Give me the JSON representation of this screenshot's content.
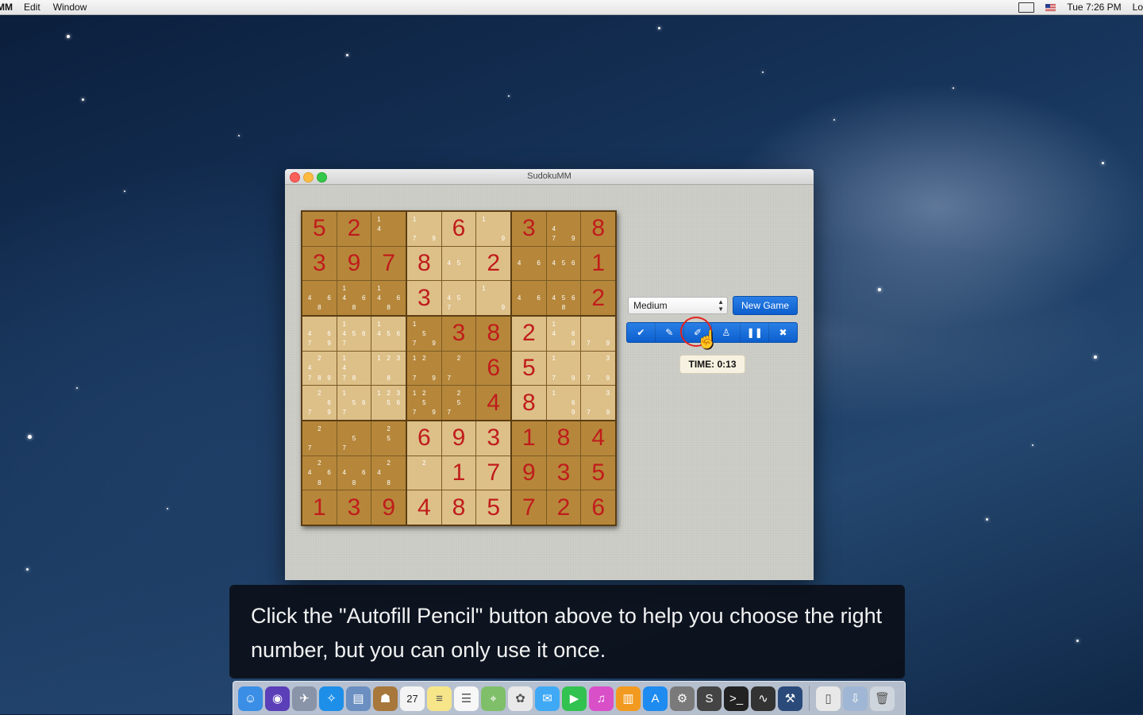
{
  "menubar": {
    "app_name": "MM",
    "menus": [
      "Edit",
      "Window"
    ],
    "clock": "Tue 7:26 PM",
    "trailing": "Lo"
  },
  "window": {
    "title": "SudokuMM"
  },
  "board": {
    "grid": [
      [
        {
          "v": "5"
        },
        {
          "v": "2"
        },
        {
          "n": [
            "1",
            "",
            "",
            "4",
            "",
            "",
            "",
            "",
            ""
          ]
        },
        {
          "n": [
            "1",
            "",
            "",
            "",
            "",
            "",
            "7",
            "",
            "9"
          ]
        },
        {
          "v": "6"
        },
        {
          "n": [
            "1",
            "",
            "",
            "",
            "",
            "",
            "",
            "",
            "9"
          ]
        },
        {
          "v": "3"
        },
        {
          "n": [
            "",
            "",
            "",
            "4",
            "",
            "",
            "7",
            "",
            "9"
          ]
        },
        {
          "v": "8"
        }
      ],
      [
        {
          "v": "3"
        },
        {
          "v": "9"
        },
        {
          "v": "7"
        },
        {
          "v": "8"
        },
        {
          "n": [
            "",
            "",
            "",
            "4",
            "5",
            "",
            "",
            "",
            ""
          ]
        },
        {
          "v": "2"
        },
        {
          "n": [
            "",
            "",
            "",
            "4",
            "",
            "6",
            "",
            "",
            ""
          ]
        },
        {
          "n": [
            "",
            "",
            "",
            "4",
            "5",
            "6",
            "",
            "",
            ""
          ]
        },
        {
          "v": "1"
        }
      ],
      [
        {
          "n": [
            "",
            "",
            "",
            "4",
            "",
            "6",
            "",
            "8",
            ""
          ]
        },
        {
          "n": [
            "1",
            "",
            "",
            "4",
            "",
            "6",
            "",
            "8",
            ""
          ]
        },
        {
          "n": [
            "1",
            "",
            "",
            "4",
            "",
            "6",
            "",
            "8",
            ""
          ]
        },
        {
          "v": "3"
        },
        {
          "n": [
            "",
            "",
            "",
            "4",
            "5",
            "",
            "7",
            "",
            ""
          ]
        },
        {
          "n": [
            "1",
            "",
            "",
            "",
            "",
            "",
            "",
            "",
            "9"
          ]
        },
        {
          "n": [
            "",
            "",
            "",
            "4",
            "",
            "6",
            "",
            "",
            ""
          ]
        },
        {
          "n": [
            "",
            "",
            "",
            "4",
            "5",
            "6",
            "",
            "8",
            ""
          ]
        },
        {
          "v": "2"
        }
      ],
      [
        {
          "n": [
            "",
            "",
            "",
            "4",
            "",
            "6",
            "7",
            "",
            "9"
          ]
        },
        {
          "n": [
            "1",
            "",
            "",
            "4",
            "5",
            "6",
            "7",
            "",
            ""
          ]
        },
        {
          "n": [
            "1",
            "",
            "",
            "4",
            "5",
            "6",
            "",
            "",
            ""
          ]
        },
        {
          "n": [
            "1",
            "",
            "",
            "",
            "5",
            "",
            "7",
            "",
            "9"
          ]
        },
        {
          "v": "3"
        },
        {
          "v": "8"
        },
        {
          "v": "2"
        },
        {
          "n": [
            "1",
            "",
            "",
            "4",
            "",
            "6",
            "",
            "",
            "9"
          ]
        },
        {
          "n": [
            "",
            "",
            "",
            "",
            "",
            "",
            "7",
            "",
            "9"
          ]
        }
      ],
      [
        {
          "n": [
            "",
            "2",
            "",
            "4",
            "",
            "",
            "7",
            "8",
            "9"
          ]
        },
        {
          "n": [
            "1",
            "",
            "",
            "4",
            "",
            "",
            "7",
            "8",
            ""
          ]
        },
        {
          "n": [
            "1",
            "2",
            "3",
            "",
            "",
            "",
            "",
            "8",
            ""
          ]
        },
        {
          "n": [
            "1",
            "2",
            "",
            "",
            "",
            "",
            "7",
            "",
            "9"
          ]
        },
        {
          "n": [
            "",
            "2",
            "",
            "",
            "",
            "",
            "7",
            "",
            ""
          ]
        },
        {
          "v": "6"
        },
        {
          "v": "5"
        },
        {
          "n": [
            "1",
            "",
            "",
            "",
            "",
            "",
            "7",
            "",
            "9"
          ]
        },
        {
          "n": [
            "",
            "",
            "3",
            "",
            "",
            "",
            "7",
            "",
            "9"
          ]
        }
      ],
      [
        {
          "n": [
            "",
            "2",
            "",
            "",
            "",
            "6",
            "7",
            "",
            "9"
          ]
        },
        {
          "n": [
            "1",
            "",
            "",
            "",
            "5",
            "6",
            "7",
            "",
            ""
          ]
        },
        {
          "n": [
            "1",
            "2",
            "3",
            "",
            "5",
            "6",
            "",
            "",
            ""
          ]
        },
        {
          "n": [
            "1",
            "2",
            "",
            "",
            "5",
            "",
            "7",
            "",
            "9"
          ]
        },
        {
          "n": [
            "",
            "2",
            "",
            "",
            "5",
            "",
            "7",
            "",
            ""
          ]
        },
        {
          "v": "4"
        },
        {
          "v": "8"
        },
        {
          "n": [
            "1",
            "",
            "",
            "",
            "",
            "6",
            "",
            "",
            "9"
          ]
        },
        {
          "n": [
            "",
            "",
            "3",
            "",
            "",
            "",
            "7",
            "",
            "9"
          ]
        }
      ],
      [
        {
          "n": [
            "",
            "2",
            "",
            "",
            "",
            "",
            "7",
            "",
            ""
          ]
        },
        {
          "n": [
            "",
            "",
            "",
            "",
            "5",
            "",
            "7",
            "",
            ""
          ]
        },
        {
          "n": [
            "",
            "2",
            "",
            "",
            "5",
            "",
            "",
            "",
            ""
          ]
        },
        {
          "v": "6"
        },
        {
          "v": "9"
        },
        {
          "v": "3"
        },
        {
          "v": "1"
        },
        {
          "v": "8"
        },
        {
          "v": "4"
        }
      ],
      [
        {
          "n": [
            "",
            "2",
            "",
            "4",
            "",
            "6",
            "",
            "8",
            ""
          ]
        },
        {
          "n": [
            "",
            "",
            "",
            "4",
            "",
            "6",
            "",
            "8",
            ""
          ]
        },
        {
          "n": [
            "",
            "2",
            "",
            "4",
            "",
            "",
            "",
            "8",
            ""
          ]
        },
        {
          "n": [
            "",
            "2",
            "",
            "",
            "",
            "",
            "",
            "",
            ""
          ]
        },
        {
          "v": "1"
        },
        {
          "v": "7"
        },
        {
          "v": "9"
        },
        {
          "v": "3"
        },
        {
          "v": "5"
        }
      ],
      [
        {
          "v": "1"
        },
        {
          "v": "3"
        },
        {
          "v": "9"
        },
        {
          "v": "4"
        },
        {
          "v": "8"
        },
        {
          "v": "5"
        },
        {
          "v": "7"
        },
        {
          "v": "2"
        },
        {
          "v": "6"
        }
      ]
    ]
  },
  "controls": {
    "difficulty_value": "Medium",
    "new_game_label": "New Game",
    "toolbar_icons": [
      "check-icon",
      "pencil-icon",
      "autofill-pencil-icon",
      "hint-icon",
      "pause-icon",
      "close-icon"
    ],
    "timer_text": "TIME: 0:13",
    "highlight_color": "#e5201b",
    "button_color": "#0c5fcd"
  },
  "caption": {
    "text": "Click the \"Autofill Pencil\" button above to help you choose the right number, but you can only use it once."
  },
  "dock": {
    "icons": [
      "finder-icon",
      "siri-icon",
      "launchpad-icon",
      "safari-icon",
      "preview-icon",
      "contacts-icon",
      "calendar-icon",
      "notes-icon",
      "reminders-icon",
      "maps-icon",
      "photos-icon",
      "messages-icon",
      "facetime-icon",
      "itunes-icon",
      "ibooks-icon",
      "app-store-icon",
      "system-preferences-icon",
      "sublime-icon",
      "terminal-icon",
      "activity-monitor-icon",
      "xcode-icon",
      "documents-icon",
      "downloads-icon",
      "trash-icon"
    ],
    "calendar_day": "27"
  }
}
